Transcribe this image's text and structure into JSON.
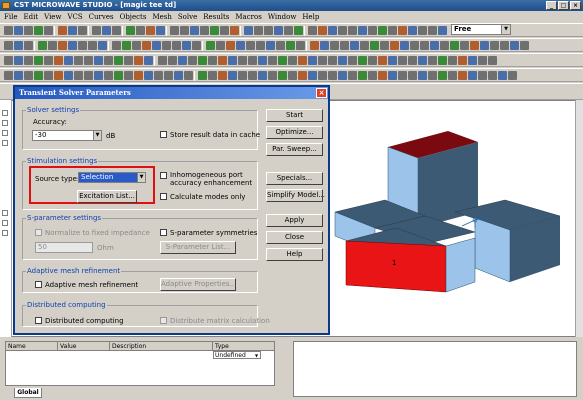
{
  "app": {
    "title": "CST MICROWAVE STUDIO - [magic tee td]",
    "menu": [
      "File",
      "Edit",
      "View",
      "VCS",
      "Curves",
      "Objects",
      "Mesh",
      "Solve",
      "Results",
      "Macros",
      "Window",
      "Help"
    ],
    "toolbar_combo": "Free"
  },
  "dialog": {
    "title": "Transient Solver Parameters",
    "close_glyph": "×",
    "solver_settings": {
      "title": "Solver settings",
      "accuracy_label": "Accuracy:",
      "accuracy_value": "-30",
      "accuracy_unit": "dB",
      "store_result_label": "Store result data in cache"
    },
    "stimulation": {
      "title": "Stimulation settings",
      "source_type_label": "Source type:",
      "source_type_value": "Selection",
      "excitation_button": "Excitation List...",
      "inhomogeneous_label_1": "Inhomogeneous port",
      "inhomogeneous_label_2": "accuracy enhancement",
      "calculate_modes_label": "Calculate modes only"
    },
    "sparameter": {
      "title": "S-parameter settings",
      "normalize_label": "Normalize to fixed impedance",
      "impedance_value": "50",
      "impedance_unit": "Ohm",
      "symmetries_label": "S-parameter symmetries",
      "list_button": "S-Parameter List..."
    },
    "adaptive": {
      "title": "Adaptive mesh refinement",
      "checkbox_label": "Adaptive mesh refinement",
      "properties_button": "Adaptive Properties..."
    },
    "distributed": {
      "title": "Distributed computing",
      "checkbox_label": "Distributed computing",
      "matrix_label": "Distribute matrix calculation"
    },
    "buttons": {
      "start": "Start",
      "optimize": "Optimize...",
      "par_sweep": "Par. Sweep...",
      "specials": "Specials...",
      "simplify": "Simplify Model...",
      "apply": "Apply",
      "close": "Close",
      "help": "Help"
    }
  },
  "scene": {
    "port_label_1": "1",
    "colors": {
      "blue_top": "#3c5a74",
      "blue_side": "#9cc4ea",
      "red_top": "#7a0a10",
      "red_front": "#e81416"
    }
  },
  "param_table": {
    "columns": [
      "Name",
      "Value",
      "Description",
      "Type"
    ],
    "type_value": "Undefined",
    "tab": "Global"
  }
}
